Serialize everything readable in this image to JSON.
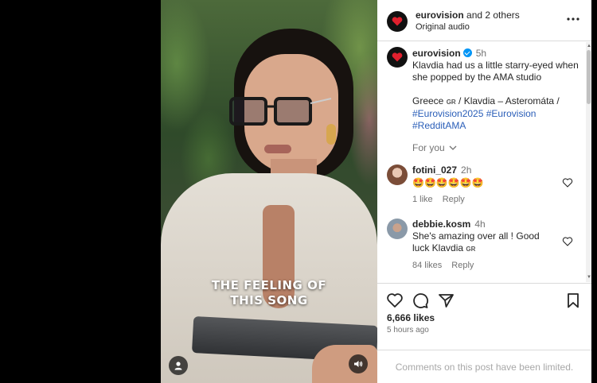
{
  "video": {
    "caption_line1": "THE FEELING OF",
    "caption_line2": "THIS SONG",
    "user_tag_icon": "person-icon",
    "mute_icon": "speaker-icon"
  },
  "header": {
    "username": "eurovision",
    "others": " and 2 others",
    "audio": "Original audio",
    "more_icon": "ellipsis-icon"
  },
  "caption": {
    "username": "eurovision",
    "time": "5h",
    "text": "Klavdia had us a little starry-eyed when she popped by the AMA studio",
    "line2_prefix": "Greece ",
    "flag_text": "GR",
    "line2_suffix": " / Klavdia – Asteromáta /",
    "hashtag1": "#Eurovision2025",
    "hashtag2": "#Eurovision",
    "hashtag3": "#RedditAMA",
    "for_you": "For you"
  },
  "comments": [
    {
      "username": "fotini_027",
      "time": "2h",
      "text": "🤩🤩🤩🤩🤩🤩",
      "likes": "1 like",
      "reply": "Reply"
    },
    {
      "username": "debbie.kosm",
      "time": "4h",
      "text": "She's amazing over all ! Good luck Klavdia ",
      "flag_text": "GR",
      "likes": "84 likes",
      "reply": "Reply"
    }
  ],
  "actions": {
    "likes": "6,666 likes",
    "time": "5 hours ago",
    "limited": "Comments on this post have been limited."
  },
  "colors": {
    "link": "#00376b",
    "hashtag": "#2a5eb8",
    "verified": "#0095f6",
    "muted": "#737373"
  }
}
